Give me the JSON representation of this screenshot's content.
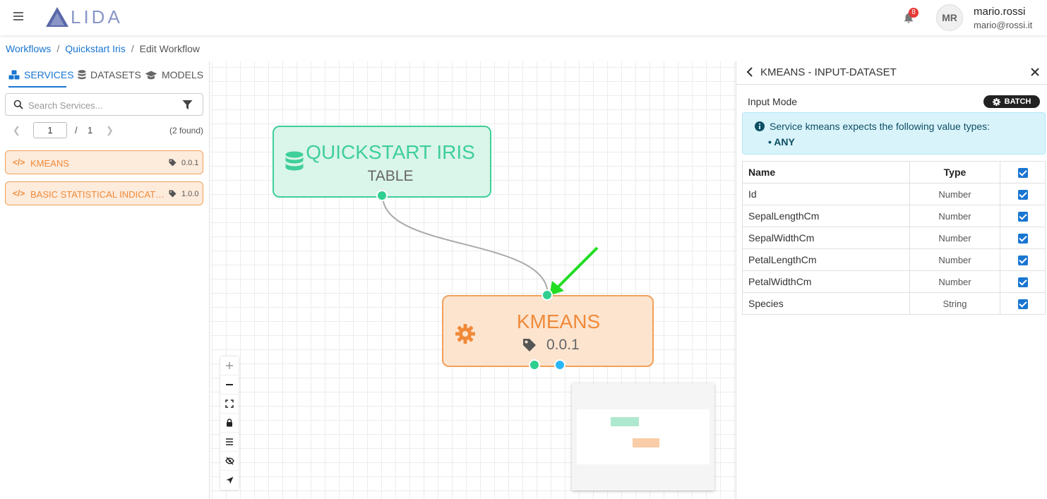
{
  "header": {
    "logo_text": "LIDA",
    "notifications_count": "8",
    "avatar_initials": "MR",
    "user_name": "mario.rossi",
    "user_email": "mario@rossi.it"
  },
  "breadcrumb": {
    "items": [
      "Workflows",
      "Quickstart Iris",
      "Edit Workflow"
    ],
    "separator": "/"
  },
  "sidebar": {
    "tabs": [
      {
        "label": "SERVICES",
        "icon": "cubes-icon",
        "active": true
      },
      {
        "label": "DATASETS",
        "icon": "database-icon",
        "active": false
      },
      {
        "label": "MODELS",
        "icon": "graduation-cap-icon",
        "active": false
      }
    ],
    "search": {
      "placeholder": "Search Services...",
      "value": ""
    },
    "pagination": {
      "current": "1",
      "separator": "/",
      "total": "1",
      "found": "(2 found)"
    },
    "services": [
      {
        "name": "KMEANS",
        "version": "0.0.1"
      },
      {
        "name": "BASIC STATISTICAL INDICATORS",
        "version": "1.0.0"
      }
    ]
  },
  "canvas": {
    "dataset_node": {
      "title": "QUICKSTART IRIS",
      "subtitle": "TABLE"
    },
    "service_node": {
      "title": "KMEANS",
      "version": "0.0.1"
    }
  },
  "panel": {
    "title": "KMEANS - INPUT-DATASET",
    "input_mode_label": "Input Mode",
    "input_mode_value": "BATCH",
    "info_message": "Service kmeans expects the following value types:",
    "info_types": "• ANY",
    "table": {
      "headers": {
        "name": "Name",
        "type": "Type"
      },
      "rows": [
        {
          "name": "Id",
          "type": "Number",
          "checked": true
        },
        {
          "name": "SepalLengthCm",
          "type": "Number",
          "checked": true
        },
        {
          "name": "SepalWidthCm",
          "type": "Number",
          "checked": true
        },
        {
          "name": "PetalLengthCm",
          "type": "Number",
          "checked": true
        },
        {
          "name": "PetalWidthCm",
          "type": "Number",
          "checked": true
        },
        {
          "name": "Species",
          "type": "String",
          "checked": true
        }
      ]
    }
  },
  "colors": {
    "primary": "#1976d2",
    "dataset_green": "#3fcf9a",
    "service_orange": "#f08a3a",
    "annotation_arrow": "#22dd22"
  }
}
